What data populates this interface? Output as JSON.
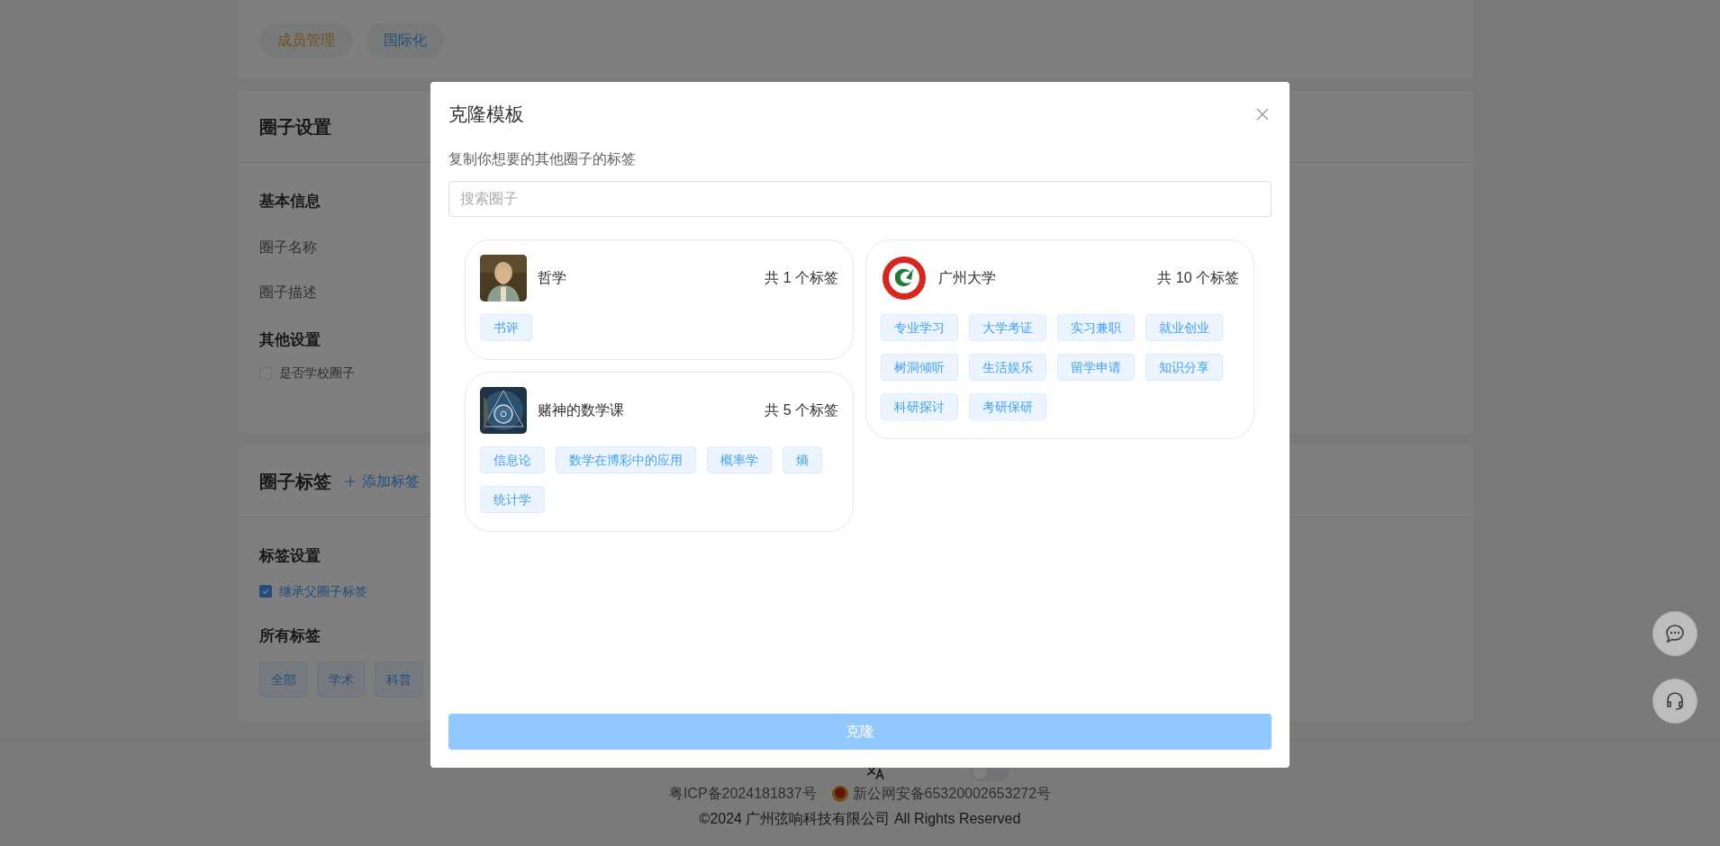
{
  "page": {
    "top_tabs": [
      {
        "label": "成员管理",
        "color": "#73511e"
      },
      {
        "label": "国际化",
        "color": "#204f80"
      }
    ],
    "settings_card": {
      "title": "圈子设置",
      "basic_heading": "基本信息",
      "fields": [
        "圈子名称",
        "圈子描述"
      ],
      "other_heading": "其他设置",
      "school_checkbox": {
        "label": "是否学校圈子",
        "checked": false
      }
    },
    "tags_card": {
      "title": "圈子标签",
      "add_link": "添加标签",
      "settings_heading": "标签设置",
      "inherit_checkbox": {
        "label": "继承父圈子标签",
        "checked": true
      },
      "all_heading": "所有标签",
      "tags": [
        "全部",
        "学术",
        "科普"
      ]
    },
    "footer": {
      "theme_switch": {
        "on": false
      },
      "icp": "粤ICP备2024181837号",
      "police": "新公网安备65320002653272号",
      "copyright": "©2024 广州弦响科技有限公司 All Rights Reserved"
    }
  },
  "dialog": {
    "title": "克隆模板",
    "subtitle": "复制你想要的其他圈子的标签",
    "search": {
      "placeholder": "搜索圈子"
    },
    "circles": [
      {
        "name": "哲学",
        "count": "共 1 个标签",
        "avatar": {
          "kind": "picture"
        },
        "tags": [
          "书评"
        ]
      },
      {
        "name": "广州大学",
        "count": "共 10 个标签",
        "avatar": {
          "kind": "emblem"
        },
        "tags": [
          "专业学习",
          "大学考证",
          "实习兼职",
          "就业创业",
          "树洞倾听",
          "生活娱乐",
          "留学申请",
          "知识分享",
          "科研探讨",
          "考研保研"
        ]
      },
      {
        "name": "赌神的数学课",
        "count": "共 5 个标签",
        "avatar": {
          "kind": "picture"
        },
        "tags": [
          "信息论",
          "数学在博彩中的应用",
          "概率学",
          "熵",
          "统计学"
        ]
      }
    ],
    "clone_button": {
      "label": "克隆",
      "disabled": true
    }
  }
}
